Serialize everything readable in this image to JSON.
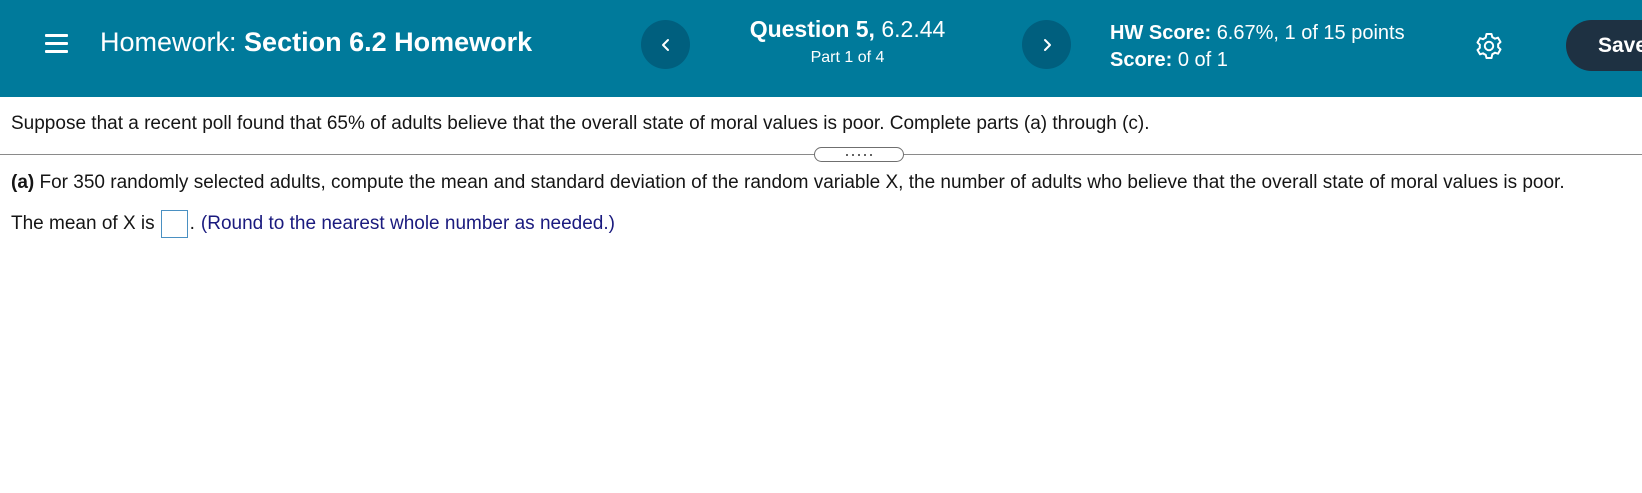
{
  "header": {
    "hw_prefix": "Homework:",
    "hw_name": "Section 6.2 Homework",
    "question_label": "Question 5,",
    "question_id": "6.2.44",
    "part_text": "Part 1 of 4",
    "hw_score_label": "HW Score:",
    "hw_score_value": "6.67%, 1 of 15 points",
    "score_label": "Score:",
    "score_value": "0 of 1",
    "save_label": "Save",
    "icons": {
      "menu": "hamburger-menu-icon",
      "prev": "chevron-left-icon",
      "next": "chevron-right-icon",
      "settings": "gear-icon"
    },
    "colors": {
      "bar": "#007a9b",
      "nav_button": "#005f7e",
      "save_button": "#1e3142"
    }
  },
  "problem": {
    "intro": "Suppose that a recent poll found that 65% of adults believe that the overall state of moral values is poor. Complete parts (a) through (c).",
    "expander_dots": "•••••",
    "part_a_label": "(a)",
    "part_a_text": " For 350 randomly selected adults, compute the mean and standard deviation of the random variable X, the number of adults who believe that the overall state of moral values is poor.",
    "answer_prefix": "The mean of X is",
    "answer_value": "",
    "answer_suffix": ".",
    "hint": "(Round to the nearest whole number as needed.)"
  }
}
